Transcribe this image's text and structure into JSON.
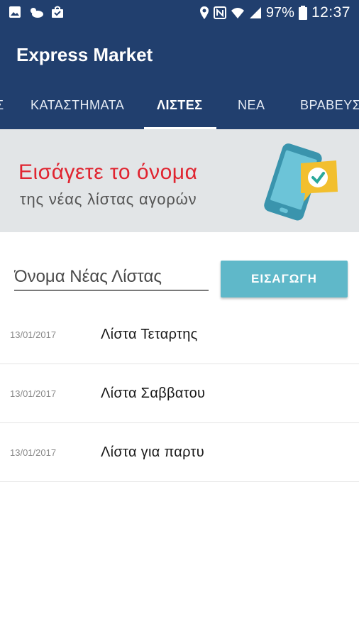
{
  "status_bar": {
    "left_icons": [
      "image-icon",
      "cloud-icon",
      "bag-icon"
    ],
    "right_icons": [
      "location-icon",
      "nfc-icon",
      "wifi-icon",
      "signal-icon",
      "battery-icon"
    ],
    "battery": "97%",
    "time": "12:37"
  },
  "app": {
    "title": "Express Market",
    "primary_color": "#213f6e",
    "accent_red": "#e02430",
    "button_color": "#5fb8c9"
  },
  "tabs": [
    {
      "label": "Σ",
      "active": false
    },
    {
      "label": "ΚΑΤΑΣΤΗΜΑΤΑ",
      "active": false
    },
    {
      "label": "ΛΙΣΤΕΣ",
      "active": true
    },
    {
      "label": "ΝΕΑ",
      "active": false
    },
    {
      "label": "ΒΡΑΒΕΥΣ",
      "active": false
    }
  ],
  "banner": {
    "title": "Εισάγετε το όνομα",
    "subtitle": "της νέας λίστας αγορών",
    "illustration": "phone-check-icon"
  },
  "new_list": {
    "placeholder": "Όνομα Νέας Λίστας",
    "value": "",
    "button_label": "ΕΙΣΑΓΩΓΗ"
  },
  "lists": [
    {
      "date": "13/01/2017",
      "name": "Λίστα Τεταρτης"
    },
    {
      "date": "13/01/2017",
      "name": "Λίστα Σαββατου"
    },
    {
      "date": "13/01/2017",
      "name": "Λίστα για παρτυ"
    }
  ]
}
